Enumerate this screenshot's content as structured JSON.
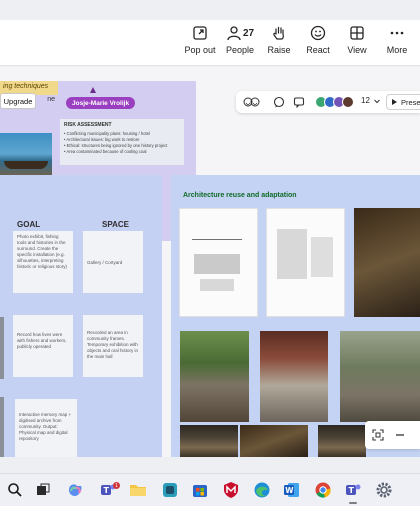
{
  "meeting_toolbar": {
    "pop_out_label": "Pop out",
    "people_label": "People",
    "people_count": "27",
    "raise_label": "Raise",
    "react_label": "React",
    "view_label": "View",
    "more_label": "More"
  },
  "whiteboard": {
    "sticky_heading": "ing techniques",
    "sticky_heading_2": "ne",
    "upgrade_label": "Upgrade",
    "collaborator_name": "Josje-Marie Vrolijk",
    "risk_box": {
      "title": "RISK ASSESSMENT",
      "lines": [
        "• Conflicting municipality plans: housing / hotel",
        "• Architectural issues: big work to restore",
        "• Ethical: structures being ignored by one history project",
        "• Area contaminated because of cooling coal"
      ]
    },
    "goal_heading": "GOAL",
    "space_heading": "SPACE",
    "goal_cards": [
      "Photo exhibit, fishing tools and histories in the surround. Create the specific installation (e.g. silhouettes, interpreting historic or religious story)",
      "Record how lives were with fishers and workers, publicly operated",
      "Interactive memory map + digitised archive from community. Output: Physical map and digital repository"
    ],
    "space_cards": [
      "Gallery / Cortyard",
      "Recorded an area in community frames. Temporary exhibition with objects and oral history in the main hall"
    ],
    "arch_title": "Architecture reuse and adaptation",
    "collab_count": "12",
    "present_label": "Prese"
  },
  "taskbar": {
    "icons": [
      "search-icon",
      "task-view-icon",
      "copilot-icon",
      "teams-icon",
      "file-explorer-icon",
      "app-icon",
      "store-icon",
      "mcafee-icon",
      "edge-icon",
      "word-icon",
      "chrome-icon",
      "teams-meeting-icon",
      "settings-icon"
    ],
    "teams_badge": "1"
  },
  "colors": {
    "violet_panel": "#d3cdf1",
    "blue_panel": "#c5d1f3",
    "collaborator_tag": "#9a3fbf",
    "arch_title_green": "#0e6b26"
  }
}
